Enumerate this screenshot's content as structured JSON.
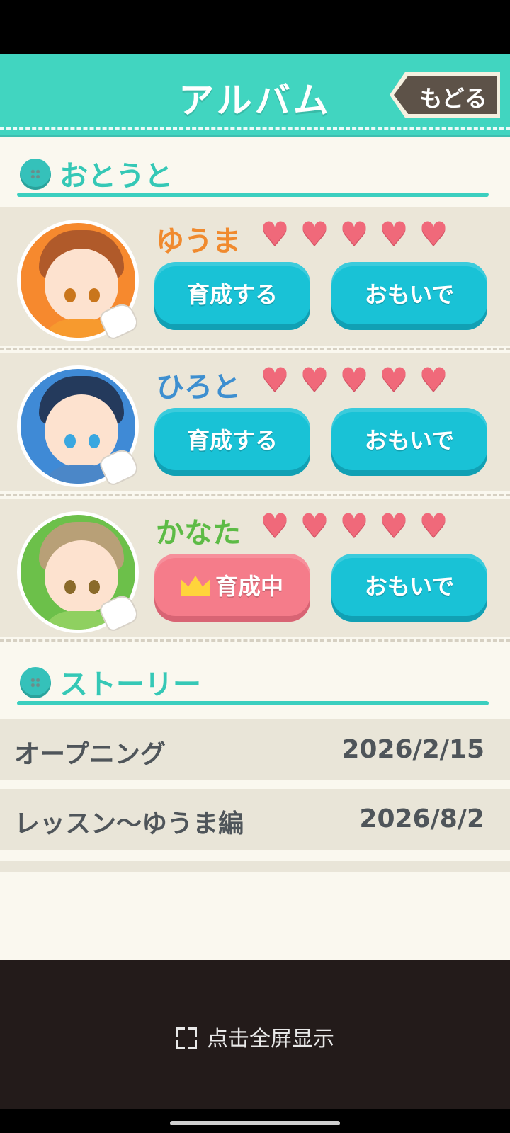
{
  "header": {
    "title": "アルバム",
    "back_label": "もどる"
  },
  "sections": {
    "brothers_label": "おとうと",
    "story_label": "ストーリー"
  },
  "characters": [
    {
      "name": "ゆうま",
      "name_color": "#f08a2e",
      "ring_color": "#f6892e",
      "hair_color": "#b05a2a",
      "eye_color": "#c9761c",
      "shirt_color": "#f79a2e",
      "hearts": [
        "♥",
        "♥",
        "♥",
        "♥",
        "♥"
      ],
      "hearts_filled": 5,
      "primary_button": "育成する",
      "primary_state": "train",
      "secondary_button": "おもいで"
    },
    {
      "name": "ひろと",
      "name_color": "#3e8fd0",
      "ring_color": "#3f8ad6",
      "hair_color": "#243a5c",
      "eye_color": "#3aa7e0",
      "shirt_color": "#4b87c8",
      "hearts": [
        "♥",
        "♥",
        "♥",
        "♥",
        "♥"
      ],
      "hearts_filled": 5,
      "primary_button": "育成する",
      "primary_state": "train",
      "secondary_button": "おもいで"
    },
    {
      "name": "かなた",
      "name_color": "#5dbb46",
      "ring_color": "#6cc04a",
      "hair_color": "#b8a077",
      "eye_color": "#8a6a2a",
      "shirt_color": "#8fd060",
      "hearts": [
        "♥",
        "♥",
        "♥",
        "♥",
        "♥"
      ],
      "hearts_filled": 5,
      "primary_button": "育成中",
      "primary_state": "in-training",
      "secondary_button": "おもいで"
    }
  ],
  "stories": [
    {
      "title": "オープニング",
      "date": "2026/2/15"
    },
    {
      "title": "レッスン〜ゆうま編",
      "date": "2026/8/2"
    }
  ],
  "system": {
    "fullscreen_label": "点击全屏显示"
  },
  "colors": {
    "accent_teal": "#41d5c0",
    "button_teal": "#19c2d6",
    "button_pink": "#f57c8a",
    "heart": "#f0697a"
  }
}
